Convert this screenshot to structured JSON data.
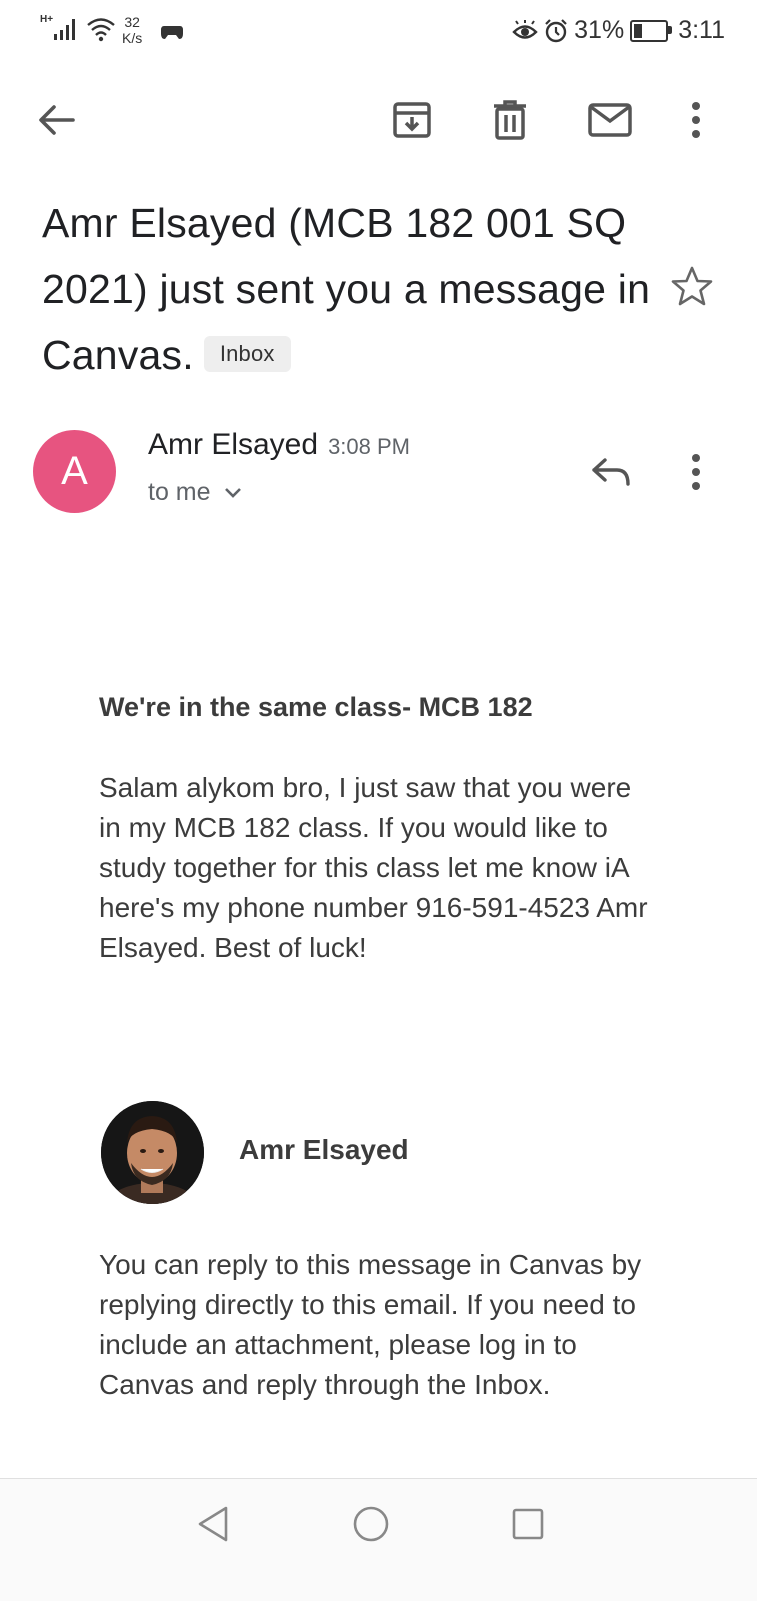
{
  "status_bar": {
    "network": "H+",
    "speed_value": "32",
    "speed_unit": "K/s",
    "battery": "31%",
    "battery_level": 0.31,
    "time": "3:11"
  },
  "toolbar": {
    "back_icon": "arrow-left-icon",
    "archive_icon": "archive-icon",
    "delete_icon": "trash-icon",
    "mark_unread_icon": "mail-icon",
    "more_icon": "more-vert-icon"
  },
  "email": {
    "subject": "Amr Elsayed (MCB 182 001 SQ 2021) just sent you a message in Canvas.",
    "label": "Inbox",
    "sender_initial": "A",
    "sender_name": "Amr Elsayed",
    "time": "3:08 PM",
    "recipient": "to me",
    "body_title": "We're in the same class- MCB 182",
    "body_message": "Salam alykom bro, I just saw that you were in my MCB 182 class. If you would like to study together for this class let me know iA here's my phone number 916-591-4523 Amr Elsayed. Best of luck!",
    "signature_name": "Amr Elsayed",
    "footer_message": "You can reply to this message in Canvas by replying directly to this email. If you need to include an attachment, please log in to Canvas and reply through the Inbox."
  },
  "colors": {
    "avatar_bg": "#e75480",
    "text": "#202124",
    "secondary": "#5f6368"
  }
}
